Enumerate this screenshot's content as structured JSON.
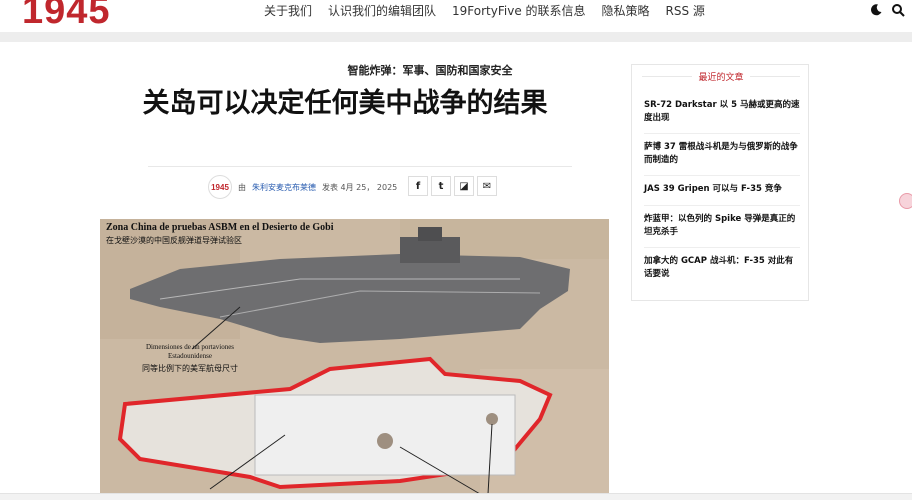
{
  "site": {
    "logo": "1945",
    "brand_color": "#c0272d"
  },
  "nav": {
    "items": [
      {
        "label": "关于我们"
      },
      {
        "label": "认识我们的编辑团队"
      },
      {
        "label": "19FortyFive 的联系信息"
      },
      {
        "label": "隐私策略"
      },
      {
        "label": "RSS 源"
      }
    ]
  },
  "icons": {
    "theme": "moon-icon",
    "search": "search-icon"
  },
  "article": {
    "category": "智能炸弹：军事、国防和国家安全",
    "title": "关岛可以决定任何美中战争的结果",
    "avatar_text": "1945",
    "by": "由",
    "author": "朱利安麦克布莱德",
    "published": "发表 4月 25， 2025",
    "share": [
      {
        "icon": "facebook-icon",
        "glyph": "f"
      },
      {
        "icon": "twitter-icon",
        "glyph": "t"
      },
      {
        "icon": "flipboard-icon",
        "glyph": "◪"
      },
      {
        "icon": "email-icon",
        "glyph": "✉"
      }
    ],
    "figure": {
      "caption_es": "Zona China de pruebas ASBM en el Desierto de Gobi",
      "caption_zh": "在戈壁沙漠的中国反舰弹道导弹试验区",
      "label_es": "Dimensiones de un portaviones Estadounidense",
      "label_zh": "同等比例下的美军航母尺寸"
    }
  },
  "sidebar": {
    "title": "最近的文章",
    "posts": [
      {
        "label": "SR-72 Darkstar 以 5 马赫或更高的速度出现"
      },
      {
        "label": "萨博 37 雷根战斗机是为与俄罗斯的战争而制造的"
      },
      {
        "label": "JAS 39 Gripen 可以与 F-35 竞争"
      },
      {
        "label": "炸蓝甲：以色列的 Spike 导弹是真正的坦克杀手"
      },
      {
        "label": "加拿大的 GCAP 战斗机：F-35 对此有话要说"
      }
    ]
  }
}
